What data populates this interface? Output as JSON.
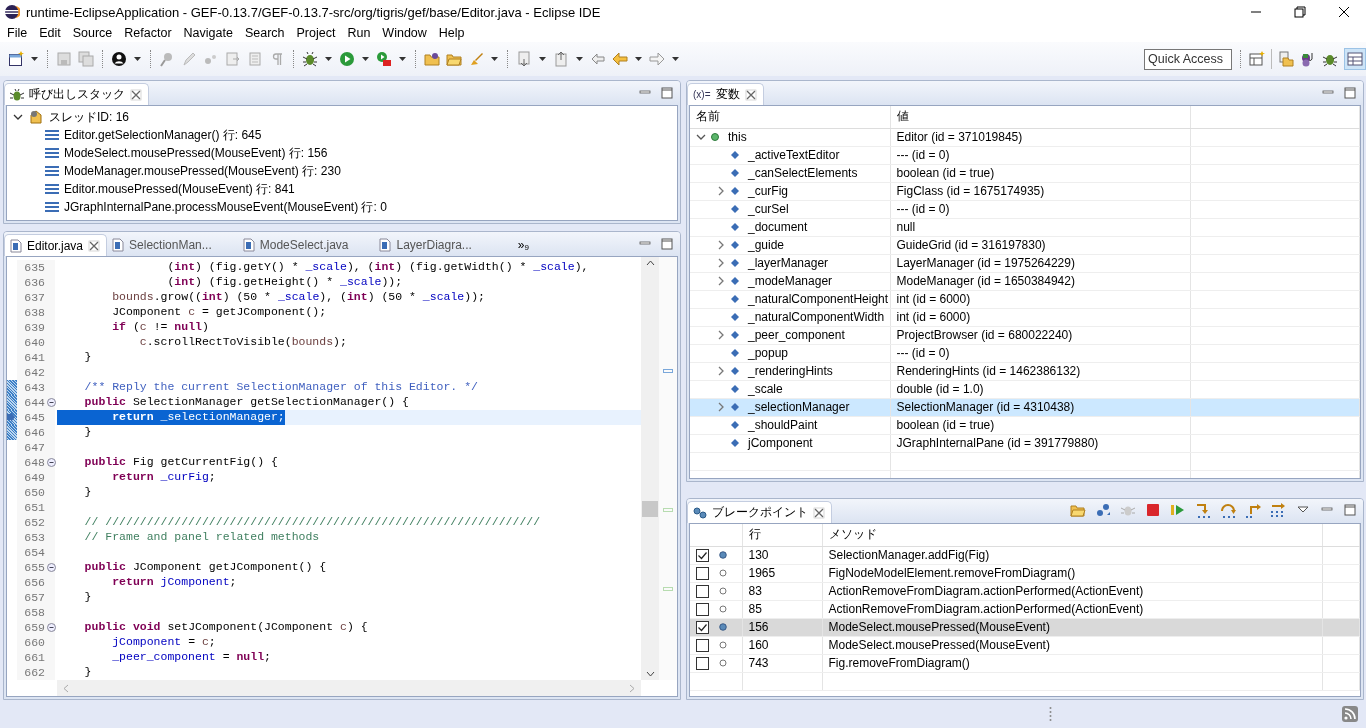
{
  "window": {
    "title": "runtime-EclipseApplication - GEF-0.13.7/GEF-0.13.7-src/org/tigris/gef/base/Editor.java - Eclipse IDE"
  },
  "menu": [
    "File",
    "Edit",
    "Source",
    "Refactor",
    "Navigate",
    "Search",
    "Project",
    "Run",
    "Window",
    "Help"
  ],
  "quick_access": {
    "placeholder": "Quick Access"
  },
  "call_stack": {
    "tab": {
      "label": "呼び出しスタック",
      "selected": true
    },
    "threads": [
      {
        "label": "スレッドID: 16",
        "expanded": true,
        "children": [
          {
            "label": "Editor.getSelectionManager() 行: 645"
          },
          {
            "label": "ModeSelect.mousePressed(MouseEvent) 行: 156"
          },
          {
            "label": "ModeManager.mousePressed(MouseEvent) 行: 230"
          },
          {
            "label": "Editor.mousePressed(MouseEvent) 行: 841"
          },
          {
            "label": "JGraphInternalPane.processMouseEvent(MouseEvent) 行: 0"
          }
        ]
      }
    ]
  },
  "editor": {
    "tabs": [
      {
        "label": "Editor.java",
        "selected": true
      },
      {
        "label": "SelectionMan...",
        "selected": false
      },
      {
        "label": "ModeSelect.java",
        "selected": false
      },
      {
        "label": "LayerDiagra...",
        "selected": false
      }
    ],
    "overflow": {
      "mark": "»",
      "count": "9"
    },
    "lines": [
      {
        "number": "635",
        "fold": false,
        "marked": false,
        "current": false,
        "selected": false,
        "segments": [
          {
            "kind": "plain",
            "text": "                ("
          },
          {
            "kind": "keyword",
            "text": "int"
          },
          {
            "kind": "plain",
            "text": ") (fig.getY() * "
          },
          {
            "kind": "field",
            "text": "_scale"
          },
          {
            "kind": "plain",
            "text": "), ("
          },
          {
            "kind": "keyword",
            "text": "int"
          },
          {
            "kind": "plain",
            "text": ") (fig.getWidth() * "
          },
          {
            "kind": "field",
            "text": "_scale"
          },
          {
            "kind": "plain",
            "text": "),"
          }
        ]
      },
      {
        "number": "636",
        "fold": false,
        "marked": false,
        "current": false,
        "selected": false,
        "segments": [
          {
            "kind": "plain",
            "text": "                ("
          },
          {
            "kind": "keyword",
            "text": "int"
          },
          {
            "kind": "plain",
            "text": ") (fig.getHeight() * "
          },
          {
            "kind": "field",
            "text": "_scale"
          },
          {
            "kind": "plain",
            "text": "));"
          }
        ]
      },
      {
        "number": "637",
        "fold": false,
        "marked": false,
        "current": false,
        "selected": false,
        "segments": [
          {
            "kind": "local",
            "text": "        bounds"
          },
          {
            "kind": "plain",
            "text": ".grow(("
          },
          {
            "kind": "keyword",
            "text": "int"
          },
          {
            "kind": "plain",
            "text": ") (50 * "
          },
          {
            "kind": "field",
            "text": "_scale"
          },
          {
            "kind": "plain",
            "text": "), ("
          },
          {
            "kind": "keyword",
            "text": "int"
          },
          {
            "kind": "plain",
            "text": ") (50 * "
          },
          {
            "kind": "field",
            "text": "_scale"
          },
          {
            "kind": "plain",
            "text": "));"
          }
        ]
      },
      {
        "number": "638",
        "fold": false,
        "marked": false,
        "current": false,
        "selected": false,
        "segments": [
          {
            "kind": "plain",
            "text": "        JComponent "
          },
          {
            "kind": "local",
            "text": "c"
          },
          {
            "kind": "plain",
            "text": " = getJComponent();"
          }
        ]
      },
      {
        "number": "639",
        "fold": false,
        "marked": false,
        "current": false,
        "selected": false,
        "segments": [
          {
            "kind": "keyword",
            "text": "        if"
          },
          {
            "kind": "plain",
            "text": " ("
          },
          {
            "kind": "local",
            "text": "c"
          },
          {
            "kind": "plain",
            "text": " != "
          },
          {
            "kind": "keyword",
            "text": "null"
          },
          {
            "kind": "plain",
            "text": ")"
          }
        ]
      },
      {
        "number": "640",
        "fold": false,
        "marked": false,
        "current": false,
        "selected": false,
        "segments": [
          {
            "kind": "local",
            "text": "            c"
          },
          {
            "kind": "plain",
            "text": ".scrollRectToVisible("
          },
          {
            "kind": "local",
            "text": "bounds"
          },
          {
            "kind": "plain",
            "text": ");"
          }
        ]
      },
      {
        "number": "641",
        "fold": false,
        "marked": false,
        "current": false,
        "selected": false,
        "segments": [
          {
            "kind": "plain",
            "text": "    }"
          }
        ]
      },
      {
        "number": "642",
        "fold": false,
        "marked": false,
        "current": false,
        "selected": false
      },
      {
        "number": "643",
        "fold": false,
        "marked": true,
        "current": false,
        "selected": false,
        "segments": [
          {
            "kind": "javadoc",
            "text": "    /** Reply the current SelectionManager of this Editor. */"
          }
        ]
      },
      {
        "number": "644",
        "fold": true,
        "marked": true,
        "current": false,
        "selected": false,
        "segments": [
          {
            "kind": "keyword",
            "text": "    public"
          },
          {
            "kind": "plain",
            "text": " SelectionManager getSelectionManager() {"
          }
        ]
      },
      {
        "number": "645",
        "fold": false,
        "marked": true,
        "current": true,
        "selected": true,
        "segments": [
          {
            "kind": "keyword",
            "text": "        return"
          },
          {
            "kind": "field",
            "text": " _selectionManager"
          },
          {
            "kind": "plain",
            "text": ";"
          }
        ]
      },
      {
        "number": "646",
        "fold": false,
        "marked": true,
        "current": false,
        "selected": false,
        "segments": [
          {
            "kind": "plain",
            "text": "    }"
          }
        ]
      },
      {
        "number": "647",
        "fold": false,
        "marked": false,
        "current": false,
        "selected": false
      },
      {
        "number": "648",
        "fold": true,
        "marked": false,
        "current": false,
        "selected": false,
        "segments": [
          {
            "kind": "keyword",
            "text": "    public"
          },
          {
            "kind": "plain",
            "text": " Fig getCurrentFig() {"
          }
        ]
      },
      {
        "number": "649",
        "fold": false,
        "marked": false,
        "current": false,
        "selected": false,
        "segments": [
          {
            "kind": "keyword",
            "text": "        return"
          },
          {
            "kind": "field",
            "text": " _curFig"
          },
          {
            "kind": "plain",
            "text": ";"
          }
        ]
      },
      {
        "number": "650",
        "fold": false,
        "marked": false,
        "current": false,
        "selected": false,
        "segments": [
          {
            "kind": "plain",
            "text": "    }"
          }
        ]
      },
      {
        "number": "651",
        "fold": false,
        "marked": false,
        "current": false,
        "selected": false
      },
      {
        "number": "652",
        "fold": false,
        "marked": false,
        "current": false,
        "selected": false,
        "segments": [
          {
            "kind": "comment",
            "text": "    // ///////////////////////////////////////////////////////////////"
          }
        ]
      },
      {
        "number": "653",
        "fold": false,
        "marked": false,
        "current": false,
        "selected": false,
        "segments": [
          {
            "kind": "comment",
            "text": "    // Frame and panel related methods"
          }
        ]
      },
      {
        "number": "654",
        "fold": false,
        "marked": false,
        "current": false,
        "selected": false
      },
      {
        "number": "655",
        "fold": true,
        "marked": false,
        "current": false,
        "selected": false,
        "segments": [
          {
            "kind": "keyword",
            "text": "    public"
          },
          {
            "kind": "plain",
            "text": " JComponent getJComponent() {"
          }
        ]
      },
      {
        "number": "656",
        "fold": false,
        "marked": false,
        "current": false,
        "selected": false,
        "segments": [
          {
            "kind": "keyword",
            "text": "        return"
          },
          {
            "kind": "field",
            "text": " jComponent"
          },
          {
            "kind": "plain",
            "text": ";"
          }
        ]
      },
      {
        "number": "657",
        "fold": false,
        "marked": false,
        "current": false,
        "selected": false,
        "segments": [
          {
            "kind": "plain",
            "text": "    }"
          }
        ]
      },
      {
        "number": "658",
        "fold": false,
        "marked": false,
        "current": false,
        "selected": false
      },
      {
        "number": "659",
        "fold": true,
        "marked": false,
        "current": false,
        "selected": false,
        "segments": [
          {
            "kind": "keyword",
            "text": "    public void"
          },
          {
            "kind": "plain",
            "text": " setJComponent(JComponent "
          },
          {
            "kind": "local",
            "text": "c"
          },
          {
            "kind": "plain",
            "text": ") {"
          }
        ]
      },
      {
        "number": "660",
        "fold": false,
        "marked": false,
        "current": false,
        "selected": false,
        "segments": [
          {
            "kind": "field",
            "text": "        jComponent"
          },
          {
            "kind": "plain",
            "text": " = "
          },
          {
            "kind": "local",
            "text": "c"
          },
          {
            "kind": "plain",
            "text": ";"
          }
        ]
      },
      {
        "number": "661",
        "fold": false,
        "marked": false,
        "current": false,
        "selected": false,
        "segments": [
          {
            "kind": "field",
            "text": "        _peer_component"
          },
          {
            "kind": "plain",
            "text": " = "
          },
          {
            "kind": "keyword",
            "text": "null"
          },
          {
            "kind": "plain",
            "text": ";"
          }
        ]
      },
      {
        "number": "662",
        "fold": false,
        "marked": false,
        "current": false,
        "selected": false,
        "segments": [
          {
            "kind": "plain",
            "text": "    }"
          }
        ]
      }
    ]
  },
  "variables": {
    "tab": {
      "icon_text": "(x)=",
      "label": "変数",
      "selected": true
    },
    "columns": [
      "名前",
      "値"
    ],
    "rows": [
      {
        "name": "this",
        "value": "Editor (id = 371019845)",
        "expandable": true,
        "expanded": true,
        "kind": "local",
        "selected": false,
        "children": [
          {
            "name": "_activeTextEditor",
            "value": "--- (id = 0)",
            "expandable": false,
            "expanded": false,
            "kind": "field",
            "selected": false
          },
          {
            "name": "_canSelectElements",
            "value": "boolean (id = true)",
            "expandable": false,
            "expanded": false,
            "kind": "field",
            "selected": false
          },
          {
            "name": "_curFig",
            "value": "FigClass (id = 1675174935)",
            "expandable": true,
            "expanded": false,
            "kind": "field",
            "selected": false
          },
          {
            "name": "_curSel",
            "value": "--- (id = 0)",
            "expandable": false,
            "expanded": false,
            "kind": "field",
            "selected": false
          },
          {
            "name": "_document",
            "value": "null",
            "expandable": false,
            "expanded": false,
            "kind": "field",
            "selected": false
          },
          {
            "name": "_guide",
            "value": "GuideGrid (id = 316197830)",
            "expandable": true,
            "expanded": false,
            "kind": "field",
            "selected": false
          },
          {
            "name": "_layerManager",
            "value": "LayerManager (id = 1975264229)",
            "expandable": true,
            "expanded": false,
            "kind": "field",
            "selected": false
          },
          {
            "name": "_modeManager",
            "value": "ModeManager (id = 1650384942)",
            "expandable": true,
            "expanded": false,
            "kind": "field",
            "selected": false
          },
          {
            "name": "_naturalComponentHeight",
            "value": "int (id = 6000)",
            "expandable": false,
            "expanded": false,
            "kind": "field",
            "selected": false
          },
          {
            "name": "_naturalComponentWidth",
            "value": "int (id = 6000)",
            "expandable": false,
            "expanded": false,
            "kind": "field",
            "selected": false
          },
          {
            "name": "_peer_component",
            "value": "ProjectBrowser (id = 680022240)",
            "expandable": true,
            "expanded": false,
            "kind": "field",
            "selected": false
          },
          {
            "name": "_popup",
            "value": "--- (id = 0)",
            "expandable": false,
            "expanded": false,
            "kind": "field",
            "selected": false
          },
          {
            "name": "_renderingHints",
            "value": "RenderingHints (id = 1462386132)",
            "expandable": true,
            "expanded": false,
            "kind": "field",
            "selected": false
          },
          {
            "name": "_scale",
            "value": "double (id = 1.0)",
            "expandable": false,
            "expanded": false,
            "kind": "field",
            "selected": false
          },
          {
            "name": "_selectionManager",
            "value": "SelectionManager (id = 4310438)",
            "expandable": true,
            "expanded": false,
            "kind": "field",
            "selected": true
          },
          {
            "name": "_shouldPaint",
            "value": "boolean (id = true)",
            "expandable": false,
            "expanded": false,
            "kind": "field",
            "selected": false
          },
          {
            "name": "jComponent",
            "value": "JGraphInternalPane (id = 391779880)",
            "expandable": false,
            "expanded": false,
            "kind": "field",
            "selected": false
          }
        ]
      }
    ]
  },
  "breakpoints": {
    "tab": {
      "label": "ブレークポイント",
      "selected": true
    },
    "columns": [
      "行",
      "メソッド"
    ],
    "rows": [
      {
        "checked": true,
        "line": "130",
        "method": "SelectionManager.addFig(Fig)",
        "selected": false
      },
      {
        "checked": false,
        "line": "1965",
        "method": "FigNodeModelElement.removeFromDiagram()",
        "selected": false
      },
      {
        "checked": false,
        "line": "83",
        "method": "ActionRemoveFromDiagram.actionPerformed(ActionEvent)",
        "selected": false
      },
      {
        "checked": false,
        "line": "85",
        "method": "ActionRemoveFromDiagram.actionPerformed(ActionEvent)",
        "selected": false
      },
      {
        "checked": true,
        "line": "156",
        "method": "ModeSelect.mousePressed(MouseEvent)",
        "selected": true
      },
      {
        "checked": false,
        "line": "160",
        "method": "ModeSelect.mousePressed(MouseEvent)",
        "selected": false
      },
      {
        "checked": false,
        "line": "743",
        "method": "Fig.removeFromDiagram()",
        "selected": false
      }
    ]
  }
}
